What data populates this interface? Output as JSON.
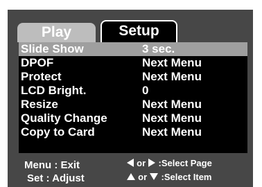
{
  "tabs": {
    "play": "Play",
    "setup": "Setup"
  },
  "menu": {
    "rows": [
      {
        "label": "Slide Show",
        "value": "3 sec.",
        "selected": true
      },
      {
        "label": "DPOF",
        "value": "Next Menu"
      },
      {
        "label": "Protect",
        "value": "Next Menu"
      },
      {
        "label": "LCD Bright.",
        "value": "0"
      },
      {
        "label": "Resize",
        "value": "Next Menu"
      },
      {
        "label": "Quality Change",
        "value": "Next Menu"
      },
      {
        "label": "Copy to Card",
        "value": "Next Menu"
      }
    ]
  },
  "footer": {
    "menu_exit": "Menu : Exit",
    "set_adjust": "Set : Adjust",
    "select_page_or": "or",
    "select_page": ":Select Page",
    "select_item_or": "or",
    "select_item": ":Select Item"
  },
  "icons": {
    "left": "left-arrow-icon",
    "right": "right-arrow-icon",
    "up": "up-arrow-icon",
    "down": "down-arrow-icon"
  },
  "colors": {
    "panel": "#474747",
    "menu_bg": "#000000",
    "highlight": "#9f9f9f",
    "tab_inactive": "#bdbdbd",
    "text": "#ffffff"
  }
}
